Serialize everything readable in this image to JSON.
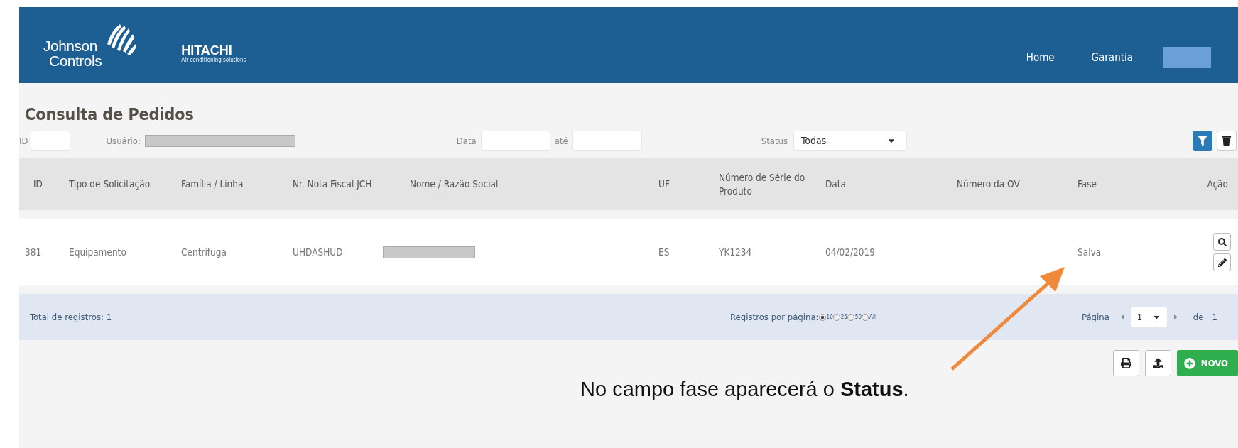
{
  "header": {
    "logo": {
      "line1": "Johnson",
      "line2": "Controls"
    },
    "brand": {
      "name": "HITACHI",
      "tagline": "Air conditioning solutions"
    },
    "nav": [
      {
        "label": "Home"
      },
      {
        "label": "Garantia"
      }
    ]
  },
  "page_title": "Consulta de Pedidos",
  "filters": {
    "id_label": "ID",
    "user_label": "Usuário:",
    "date_label": "Data",
    "until_label": "até",
    "status_label": "Status",
    "status_value": "Todas"
  },
  "table": {
    "columns": [
      "ID",
      "Tipo de Solicitação",
      "Família / Linha",
      "Nr. Nota Fiscal JCH",
      "Nome / Razão Social",
      "UF",
      "Número de Série do Produto",
      "Data",
      "Número da OV",
      "Fase",
      "Ação"
    ],
    "rows": [
      {
        "cells": [
          "381",
          "Equipamento",
          "Centrifuga",
          "UHDASHUD",
          "",
          "ES",
          "YK1234",
          "04/02/2019",
          "",
          "Salva"
        ]
      }
    ]
  },
  "footer": {
    "total": "Total de registros: 1",
    "per_page_label": "Registros por página:",
    "per_page_options": [
      {
        "label": "10",
        "selected": true
      },
      {
        "label": "25",
        "selected": false
      },
      {
        "label": "50",
        "selected": false
      },
      {
        "label": "All",
        "selected": false
      }
    ],
    "page_label": "Página",
    "page_value": "1",
    "of_label": "de",
    "page_count": "1"
  },
  "new_button": "NOVO",
  "annotation": "No campo fase aparecerá o **Status**."
}
